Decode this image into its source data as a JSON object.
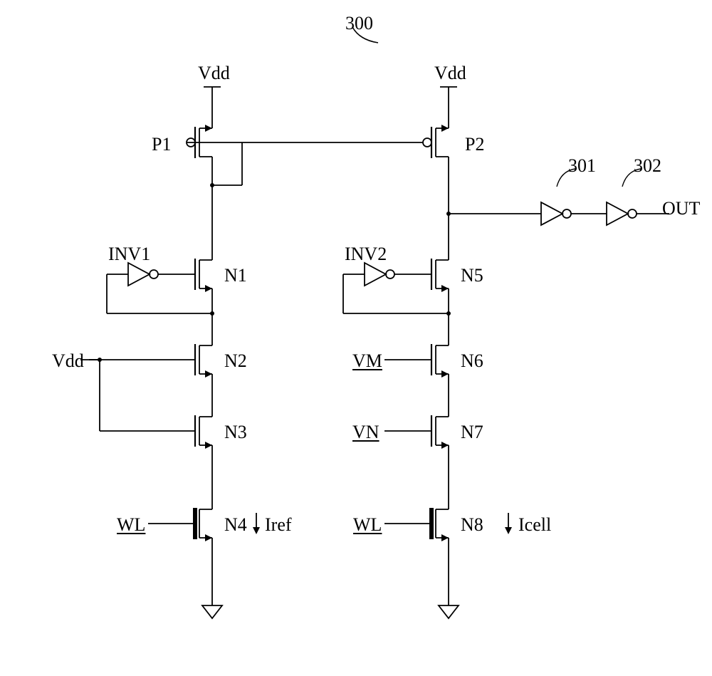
{
  "title_ref": "300",
  "supply_left": "Vdd",
  "supply_right": "Vdd",
  "pmos_left": "P1",
  "pmos_right": "P2",
  "inv_left": "INV1",
  "inv_right": "INV2",
  "inv_ref_301": "301",
  "inv_ref_302": "302",
  "output": "OUT",
  "n1": "N1",
  "n2": "N2",
  "n3": "N3",
  "n4": "N4",
  "n5": "N5",
  "n6": "N6",
  "n7": "N7",
  "n8": "N8",
  "vdd_gate": "Vdd",
  "vm": "VM",
  "vn": "VN",
  "wl_left": "WL",
  "wl_right": "WL",
  "iref": "Iref",
  "icell": "Icell"
}
